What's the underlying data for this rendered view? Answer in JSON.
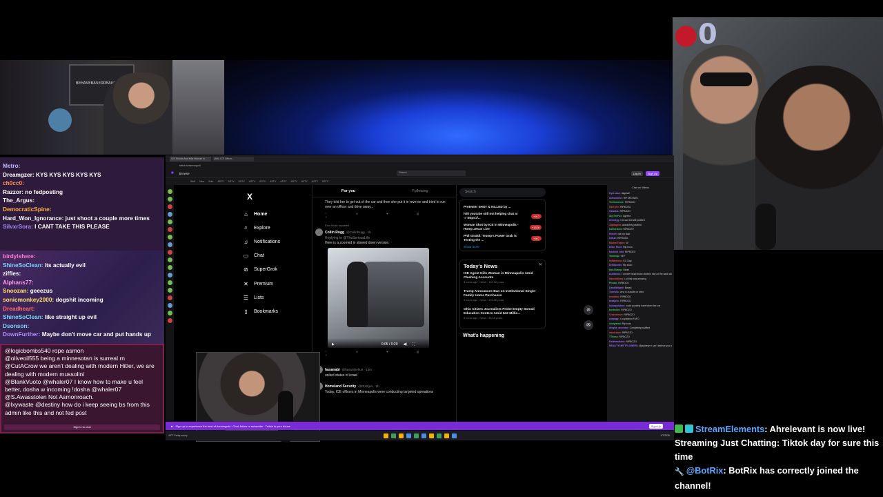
{
  "left_chat_top": [
    {
      "user": "Metro",
      "color": "#b9b9ff",
      "text": ""
    },
    {
      "user": "Dreamgzer",
      "color": "#ffffff",
      "text": "KYS KYS KYS KYS KYS"
    },
    {
      "user": "ch0cc0",
      "color": "#ff8f5a",
      "text": ""
    },
    {
      "user": "Razzor",
      "color": "#ffffff",
      "text": "no fedposting"
    },
    {
      "user": "The_Argus",
      "color": "#ffffff",
      "text": ""
    },
    {
      "user": "DemocraticSpine",
      "color": "#ffb347",
      "text": ""
    },
    {
      "user": "Hard_Won_Ignorance",
      "color": "#ffffff",
      "text": "just shoot a couple more times"
    },
    {
      "user": "SilvxrSora",
      "color": "#a58cff",
      "text": "I CANT TAKE THIS PLEASE"
    }
  ],
  "left_chat_mid": [
    {
      "user": "birdyishere",
      "color": "#ff7bd5",
      "text": ""
    },
    {
      "user": "ShineSoClean",
      "color": "#7ad7ff",
      "text": "its actually evil"
    },
    {
      "user": "ziffles",
      "color": "#ffffff",
      "text": ""
    },
    {
      "user": "Alphans77",
      "color": "#ff9bf0",
      "text": ""
    },
    {
      "user": "Snoozan",
      "color": "#ffe06b",
      "text": "geeezus"
    },
    {
      "user": "sonicmonkey2000",
      "color": "#ffe06b",
      "text": "dogshit incoming"
    },
    {
      "user": "Dreadheart",
      "color": "#ff6b6b",
      "text": ""
    },
    {
      "user": "ShineSoClean",
      "color": "#7ad7ff",
      "text": "like straight up evil"
    },
    {
      "user": "Dsonson",
      "color": "#7ad7ff",
      "text": ""
    },
    {
      "user": "DownFurther",
      "color": "#b58cff",
      "text": "Maybe don't move car and put hands up"
    }
  ],
  "left_chat_bottom": [
    {
      "user": "@logicbombs540",
      "text": "rope asmon"
    },
    {
      "user": "@oliveoil555",
      "text": "being a minnesotan is surreal rn"
    },
    {
      "user": "@CutACrow",
      "text": "we aren't dealing with modern Hitler, we are dealing with modern mussolini"
    },
    {
      "user": "@BlankVuoto",
      "text": "@whaler07 I know how to make u feel better, dosha w incoming !dosha @whaler07"
    },
    {
      "user": "@S.Awasstolen",
      "text": "Not Asmonroach."
    },
    {
      "user": "@lxywaste",
      "text": "@destiny how do i keep seeing bs from this admin like this and not fed post"
    }
  ],
  "left_chat_signin": "Sign in to chat",
  "browser": {
    "tabs": [
      "ICE Shoots And Kills Woman in",
      "(360) ICE Officer..."
    ],
    "url": "twitch.tv/asmongold",
    "browse": "Browse",
    "search_placeholder": "Search",
    "login": "Log In",
    "signup": "Sign Up",
    "bookmarks": [
      "Stuff",
      "New",
      "Shirt",
      "ASTV",
      "ASTV",
      "ASTV",
      "ASTV",
      "ASTV",
      "ASTV",
      "ASTV",
      "ASTV",
      "ASTV",
      "ASTV",
      "ASTV"
    ]
  },
  "x_nav": {
    "logo": "X",
    "items": [
      {
        "label": "Home",
        "icon": "⌂"
      },
      {
        "label": "Explore",
        "icon": "⌕"
      },
      {
        "label": "Notifications",
        "icon": "♫"
      },
      {
        "label": "Chat",
        "icon": "▭"
      },
      {
        "label": "SuperGrok",
        "icon": "⊘"
      },
      {
        "label": "Premium",
        "icon": "✕"
      },
      {
        "label": "Lists",
        "icon": "☰"
      },
      {
        "label": "Bookmarks",
        "icon": "▯"
      }
    ]
  },
  "x_feed": {
    "tab_for_you": "For you",
    "tab_following": "Following",
    "tweet1_text": "They told her to get out of the car and then she put it in reverse and tried to run over an officer and drive away...",
    "repost_label": "Elon Musk reposted",
    "tweet2_name": "Collin Rugg",
    "tweet2_handle": "@CollinRugg · 1h",
    "tweet2_reply": "Replying to @TheSeriousLife",
    "tweet2_text": "Here is a zoomed in slowed down version.",
    "video_time": "0:05 / 0:20",
    "tweet3_name": "hasanabi",
    "tweet3_handle": "@hasanthehun · 13m",
    "tweet3_text": "united states of israel",
    "tweet4_name": "Homeland Security",
    "tweet4_handle": "@DHSgov · 2h",
    "tweet4_text": "Today, ICE officers in Minneapolis were conducting targeted operations"
  },
  "x_right": {
    "search": "Search",
    "trends": [
      {
        "text": "Protester SHOT & KILLED by ...",
        "badge": ""
      },
      {
        "text": "hiiii youtube still not helping chat at -> https://...",
        "badge": "+917"
      },
      {
        "text": "Woman Shot by ICE in Minneapolis - Hotep Jesus Live",
        "badge": "+1626"
      },
      {
        "text": "Phil Giraldi: Trump's Power Grab is Testing the ...",
        "badge": "+607"
      }
    ],
    "show_more": "Show more",
    "news_title": "Today's News",
    "news": [
      {
        "title": "ICE Agent Kills Woman in Minneapolis Amid Clashing Accounts",
        "meta": "3 hours ago · News · 109.5K posts"
      },
      {
        "title": "Trump Announces Ban on Institutional Single-Family Home Purchases",
        "meta": "3 hours ago · News · 101.8K posts"
      },
      {
        "title": "Ohio Citizen Journalists Probe Empty Somali Education Centers Amid $42 Millio...",
        "meta": "5 hours ago · News · 48.1K posts"
      }
    ],
    "whats_happening": "What's happening"
  },
  "side_chat": {
    "header": "Chat on Videos",
    "lines": [
      {
        "u": "Kyurosan",
        "t": "dsgdsdf"
      },
      {
        "u": "carlosnic57",
        "t": "RIP MICHAEL"
      },
      {
        "u": "TheImmense",
        "t": "RIPBOZO"
      },
      {
        "u": "Geerpier",
        "t": "RIPBOZO"
      },
      {
        "u": "Gstarkis",
        "t": "RIPBOZO"
      },
      {
        "u": "SkyTheFox",
        "t": "Agreed"
      },
      {
        "u": "deronlyg",
        "t": "it is sad but still justified"
      },
      {
        "u": "ZigMagnet",
        "t": "absolutely justified"
      },
      {
        "u": "hallmelanie",
        "t": "RIPBOZO"
      },
      {
        "u": "Hunch",
        "t": "not my fault"
      },
      {
        "u": "kiitsar",
        "t": "RIPBOZO"
      },
      {
        "u": "ModestTrader",
        "t": "W"
      },
      {
        "u": "Dwin_Ruce",
        "t": "Rip bozo"
      },
      {
        "u": "hochenl_bibi",
        "t": "RIPBOZO"
      },
      {
        "u": "Vamrnap",
        "t": "YEP"
      },
      {
        "u": "ItsNatelovo",
        "t": "EZ Clap"
      },
      {
        "u": "Drillboonts",
        "t": "Rip bozo"
      },
      {
        "u": "bhd2Jdanp",
        "t": "Clean"
      },
      {
        "u": "Dudkeinic",
        "t": "I wonder what those stickers say on the back window"
      },
      {
        "u": "NoorahDeep",
        "t": "Lol that was amazing"
      },
      {
        "u": "Phnasi",
        "t": "RIPBOZO"
      },
      {
        "u": "DeadWidgett",
        "t": "Based"
      },
      {
        "u": "Tnarwilo",
        "t": "who is outside on wino"
      },
      {
        "u": "emulator",
        "t": "RIPBOZO"
      },
      {
        "u": "bradjpxx",
        "t": "RIPBOZO"
      },
      {
        "u": "huiyspolahan",
        "t": "could possibly have taken her car"
      },
      {
        "u": "bsvtrukhi",
        "t": "RIPBOZO"
      },
      {
        "u": "Cresvelmon",
        "t": "RIPBOZO"
      },
      {
        "u": "zzayagg",
        "t": "1 population FAFO"
      },
      {
        "u": "Andyhinat",
        "t": "Rip bozo"
      },
      {
        "u": "dezyba_ancestor",
        "t": "Completely justified"
      },
      {
        "u": "manicdow",
        "t": "RIPBOZO"
      },
      {
        "u": "TTIvesz",
        "t": "RIPBOZO"
      },
      {
        "u": "DealhandIdon",
        "t": "RIPBOZO"
      },
      {
        "u": "REALITYSHIFTFLOWERS",
        "t": "@jackieyer i can't believe you wanna live in a fascist state where you can't ever pick officers"
      }
    ]
  },
  "banner": {
    "text": "Sign up to experience the best of Asmongold · Chat, follow or subscribe · Twitch is your house",
    "signup": "Sign Up"
  },
  "taskbar": {
    "weather": "49°F Partly sunny",
    "clock": "1/7/2026"
  },
  "events": [
    {
      "icon_label": "✓",
      "user": "StreamElements",
      "text": ": Ahrelevant is now live! Streaming Just Chatting: Tiktok day for sure this time"
    },
    {
      "icon_label": "🔧",
      "user": "@BotRix",
      "text": ": BotRix has correctly joined the channel!"
    }
  ],
  "cam_right_logo": "0",
  "cam_top_left_shelf_text": "BEHAVEBASEDDRAGOS NORTHRIDGE"
}
